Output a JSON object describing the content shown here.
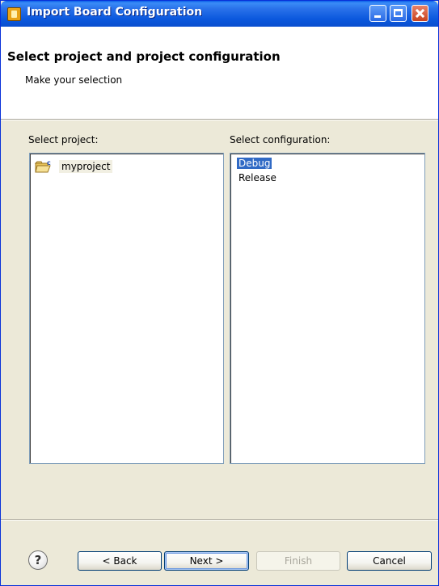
{
  "window": {
    "title": "Import Board Configuration",
    "controls": {
      "minimize": "minimize-icon",
      "maximize": "maximize-icon",
      "close": "close-icon"
    }
  },
  "header": {
    "title": "Select project and project configuration",
    "subtitle": "Make your selection"
  },
  "project_panel": {
    "label": "Select project:",
    "items": [
      {
        "label": "myproject",
        "icon": "c-project-folder-icon"
      }
    ]
  },
  "config_panel": {
    "label": "Select configuration:",
    "items": [
      {
        "label": "Debug",
        "selected": true
      },
      {
        "label": "Release",
        "selected": false
      }
    ]
  },
  "buttons": {
    "help": "?",
    "back": "< Back",
    "next": "Next >",
    "finish": "Finish",
    "cancel": "Cancel"
  },
  "colors": {
    "titlebar": "#0a58dd",
    "selection": "#316ac5",
    "dialog_bg": "#ece9d8"
  }
}
